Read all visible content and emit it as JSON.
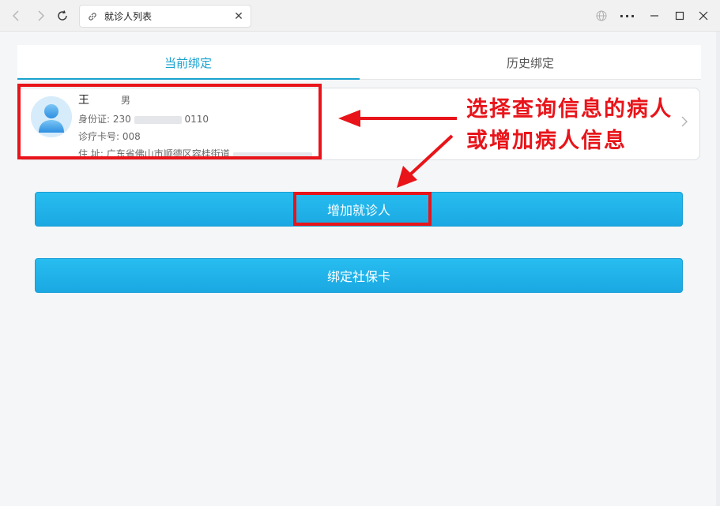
{
  "browser": {
    "tab_title": "就诊人列表"
  },
  "tabs": [
    {
      "label": "当前绑定"
    },
    {
      "label": "历史绑定"
    }
  ],
  "patient": {
    "name": "王",
    "gender": "男",
    "id_label": "身份证:",
    "id_value_start": "230",
    "id_value_end": "0110",
    "card_label": "诊疗卡号:",
    "card_value": "008",
    "addr_label": "住  址:",
    "addr_value": "广东省佛山市顺德区容桂街道"
  },
  "buttons": {
    "add": "增加就诊人",
    "bind": "绑定社保卡"
  },
  "annotation": {
    "line1": "选择查询信息的病人",
    "line2": "或增加病人信息",
    "color": "#e8141a"
  },
  "colors": {
    "accent": "#1aa3cf",
    "button": "#22b3ea"
  }
}
